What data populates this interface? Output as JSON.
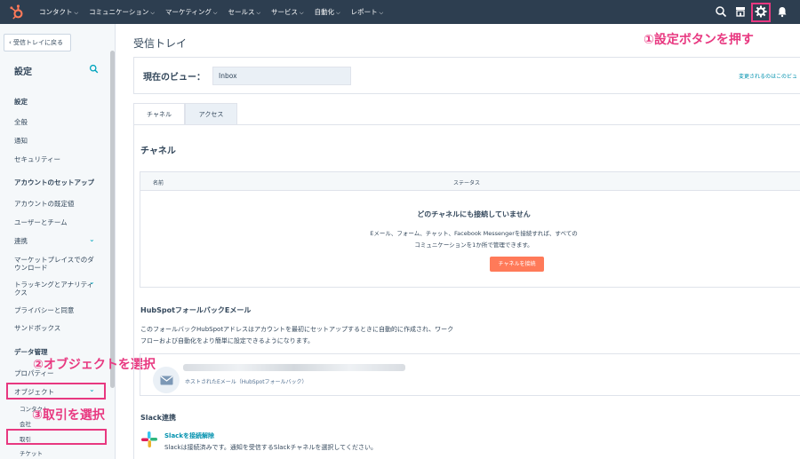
{
  "topnav": {
    "items": [
      {
        "label": "コンタクト"
      },
      {
        "label": "コミュニケーション"
      },
      {
        "label": "マーケティング"
      },
      {
        "label": "セールス"
      },
      {
        "label": "サービス"
      },
      {
        "label": "自動化"
      },
      {
        "label": "レポート"
      }
    ]
  },
  "sidebar": {
    "back_label": "受信トレイに戻る",
    "title": "設定",
    "items": [
      {
        "label": "設定"
      },
      {
        "label": "全般"
      },
      {
        "label": "通知"
      },
      {
        "label": "セキュリティー"
      },
      {
        "label": "アカウントのセットアップ"
      },
      {
        "label": "アカウントの既定値"
      },
      {
        "label": "ユーザーとチーム"
      },
      {
        "label": "連携"
      },
      {
        "label": "マーケットプレイスでのダウンロード"
      },
      {
        "label": "トラッキングとアナリティクス"
      },
      {
        "label": "プライバシーと同意"
      },
      {
        "label": "サンドボックス"
      },
      {
        "label": "データ管理"
      },
      {
        "label": "プロパティー"
      },
      {
        "label": "オブジェクト"
      }
    ],
    "sub_items": [
      {
        "label": "コンタクト"
      },
      {
        "label": "会社"
      },
      {
        "label": "取引"
      },
      {
        "label": "チケット"
      }
    ]
  },
  "annotations": {
    "step1": "①設定ボタンを押す",
    "step2": "②オブジェクトを選択",
    "step3": "③取引を選択"
  },
  "main": {
    "page_title": "受信トレイ",
    "view_label": "現在のビュー：",
    "view_value": "Inbox",
    "view_note": "変更されるのはこのビュ",
    "tabs": [
      {
        "label": "チャネル"
      },
      {
        "label": "アクセス"
      }
    ],
    "channels": {
      "title": "チャネル",
      "col_name": "名前",
      "col_status": "ステータス",
      "empty_title": "どのチャネルにも接続していません",
      "empty_line1": "Eメール、フォーム、チャット、Facebook Messengerを接続すれば、すべての",
      "empty_line2": "コミュニケーションを1か所で管理できます。",
      "connect_button": "チャネルを接続"
    },
    "fallback": {
      "title": "HubSpotフォールバックEメール",
      "desc_line1": "このフォールバックHubSpotアドレスはアカウントを最初にセットアップするときに自動的に作成され、ワーク",
      "desc_line2": "フローおよび自動化をより簡単に設定できるようになります。",
      "caption": "ホストされたEメール（HubSpotフォールバック）"
    },
    "slack": {
      "title": "Slack連携",
      "link": "Slackを接続解除",
      "desc": "Slackは接続済みです。通知を受信するSlackチャネルを選択してください。"
    }
  },
  "colors": {
    "nav_bg": "#2d3e50",
    "accent": "#ff7a59",
    "link": "#0091ae",
    "annotation": "#e83880"
  }
}
